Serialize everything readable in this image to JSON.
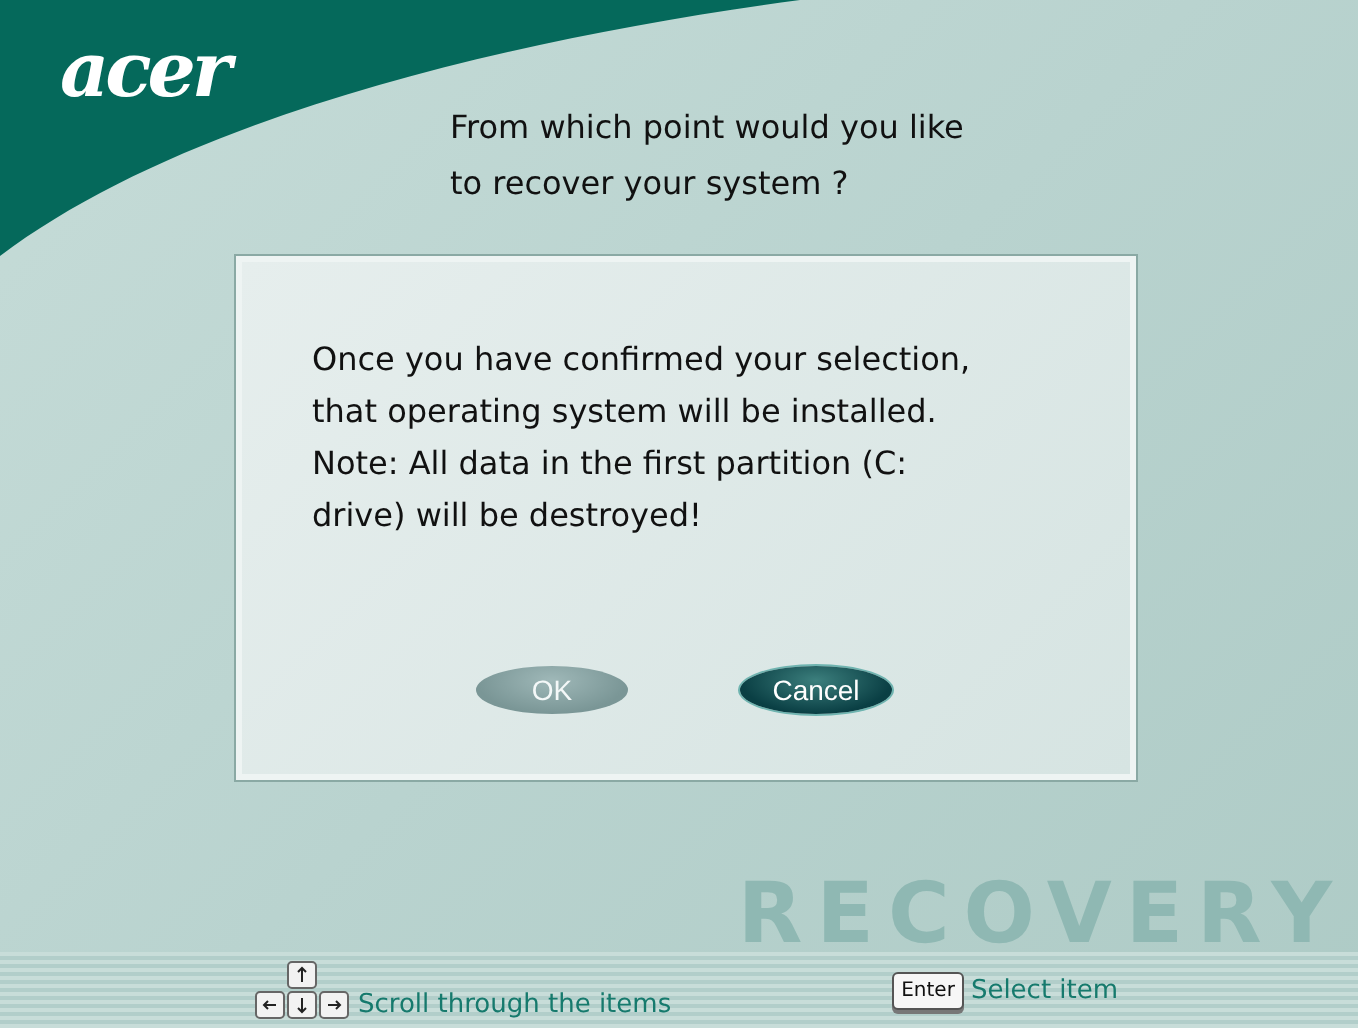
{
  "logo": "acer",
  "title": "From which point would you like\nto recover your system ?",
  "dialog": {
    "message": "Once you have confirmed your selection,\nthat operating system will be installed.\nNote: All data in the first partition (C:\ndrive) will be destroyed!",
    "buttons": [
      {
        "label": "OK",
        "disabled": true
      },
      {
        "label": "Cancel",
        "disabled": false
      }
    ]
  },
  "watermark": "RECOVERY",
  "footer": {
    "hints": [
      {
        "kind": "arrows",
        "text": "Scroll through the items"
      },
      {
        "kind": "key",
        "key": "Enter",
        "text": "Select item"
      }
    ]
  }
}
